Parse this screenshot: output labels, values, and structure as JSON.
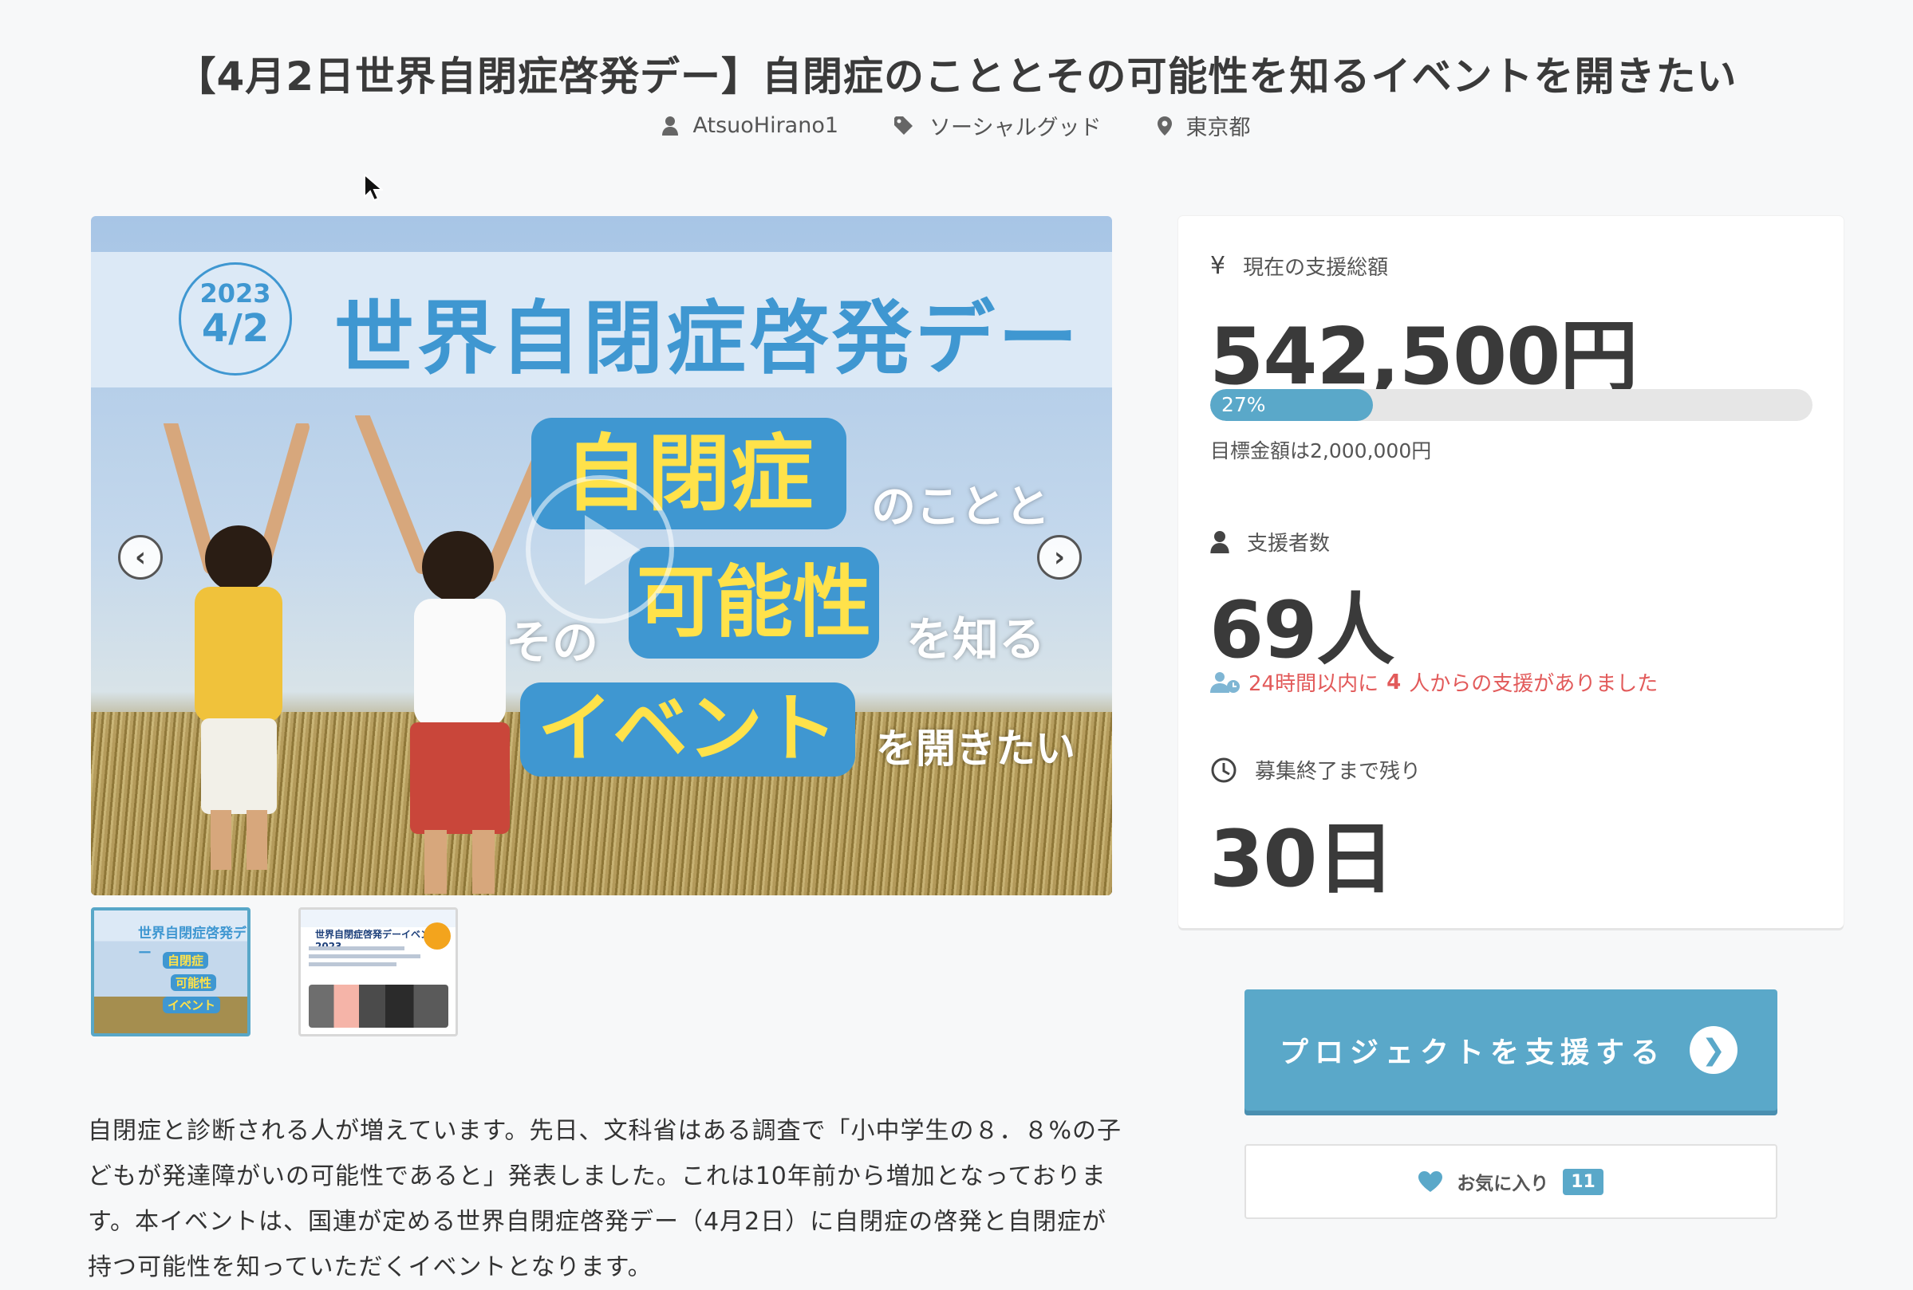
{
  "page": {
    "title": "【4月2日世界自閉症啓発デー】自閉症のこととその可能性を知るイベントを開きたい"
  },
  "meta": {
    "author": "AtsuoHirano1",
    "category": "ソーシャルグッド",
    "location": "東京都"
  },
  "hero": {
    "year": "2023",
    "date": "4/2",
    "headline": "世界自閉症啓発デー",
    "word1": "自閉症",
    "text1": "のことと",
    "text2": "その",
    "word2": "可能性",
    "text3": "を知る",
    "word3": "イベント",
    "text4": "を開きたい"
  },
  "thumbnails": {
    "t1_title": "世界自閉症啓発デー",
    "t1_w1": "自閉症",
    "t1_w2": "可能性",
    "t1_w3": "イベント",
    "t2_title": "世界自閉症啓発デーイベント2023"
  },
  "description": "自閉症と診断される人が増えています。先日、文科省はある調査で「小中学生の８．８%の子どもが発達障がいの可能性であると」発表しました。これは10年前から増加となっております。本イベントは、国連が定める世界自閉症啓発デー（4月2日）に自閉症の啓発と自閉症が持つ可能性を知っていただくイベントとなります。",
  "stats": {
    "amount_label": "現在の支援総額",
    "amount": "542,500円",
    "progress_percent": 27,
    "progress_label": "27%",
    "goal": "目標金額は2,000,000円",
    "backers_label": "支援者数",
    "backers": "69人",
    "recent_prefix": "24時間以内に",
    "recent_count": "4",
    "recent_suffix": "人からの支援がありました",
    "remaining_label": "募集終了まで残り",
    "remaining": "30日"
  },
  "actions": {
    "support_label": "プロジェクトを支援する",
    "favorite_label": "お気に入り",
    "favorite_count": "11"
  },
  "colors": {
    "accent": "#5aa8c9",
    "hero_blue": "#3f97d1",
    "alert": "#e25a5a"
  },
  "icons": [
    "user-icon",
    "tag-icon",
    "pin-icon",
    "yen-icon",
    "clock-icon",
    "heart-icon",
    "chevron-right-icon"
  ]
}
